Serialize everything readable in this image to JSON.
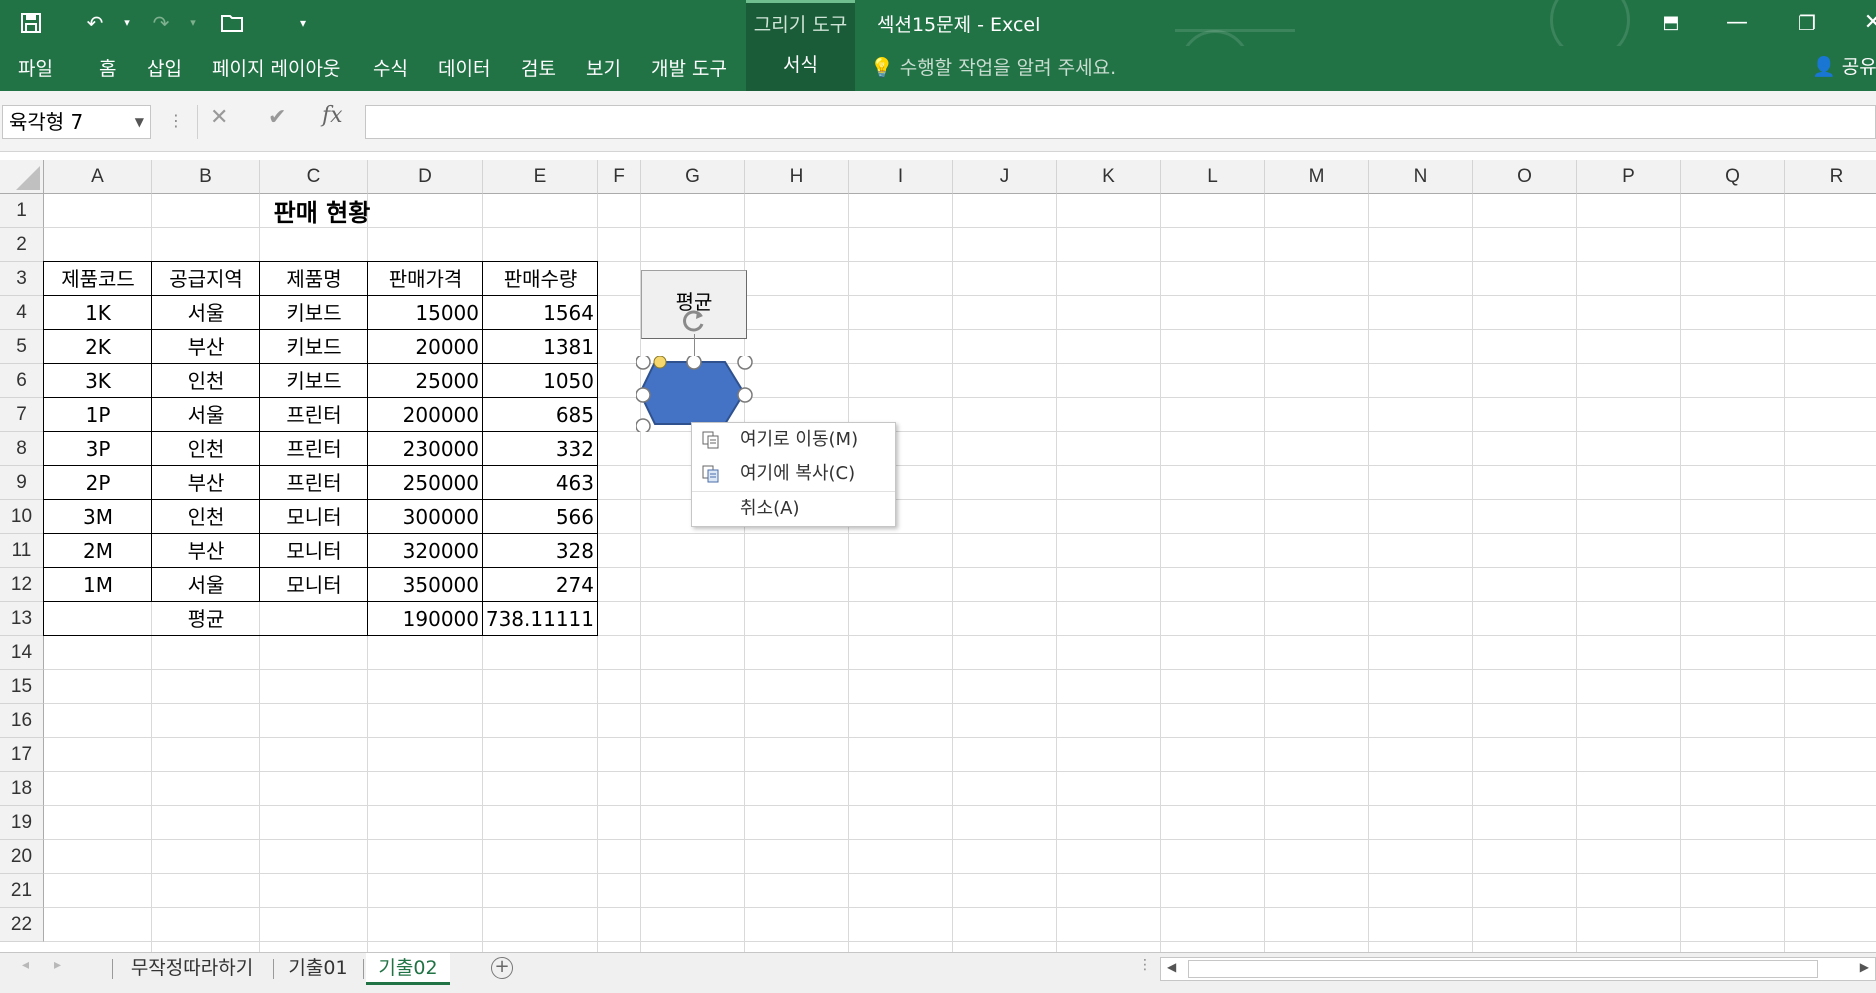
{
  "window": {
    "title": "섹션15문제 - Excel",
    "contextual_group": "그리기 도구",
    "colors": {
      "ribbon": "#217346",
      "contextual": "#1a5c38",
      "shape_fill": "#4472c4",
      "active_tab": "#217346"
    }
  },
  "qat": {
    "save_icon": "save-icon",
    "undo_icon": "undo-icon",
    "redo_icon": "redo-icon",
    "open_icon": "open-icon",
    "customize_icon": "customize-icon"
  },
  "ribbon": {
    "tabs": [
      "파일",
      "홈",
      "삽입",
      "페이지 레이아웃",
      "수식",
      "데이터",
      "검토",
      "보기",
      "개발 도구",
      "서식"
    ],
    "tell_me": "수행할 작업을 알려 주세요.",
    "share": "공유"
  },
  "formula_bar": {
    "name_box": "육각형 7",
    "fx_label": "fx",
    "cancel_glyph": "✕",
    "enter_glyph": "✔",
    "formula": ""
  },
  "grid": {
    "columns": [
      "A",
      "B",
      "C",
      "D",
      "E",
      "F",
      "G",
      "H",
      "I",
      "J",
      "K",
      "L",
      "M",
      "N",
      "O",
      "P",
      "Q",
      "R"
    ],
    "rows": [
      "1",
      "2",
      "3",
      "4",
      "5",
      "6",
      "7",
      "8",
      "9",
      "10",
      "11",
      "12",
      "13",
      "14",
      "15",
      "16",
      "17",
      "18",
      "19",
      "20",
      "21",
      "22"
    ]
  },
  "table": {
    "title": "판매 현황",
    "headers": [
      "제품코드",
      "공급지역",
      "제품명",
      "판매가격",
      "판매수량"
    ],
    "rows": [
      [
        "1K",
        "서울",
        "키보드",
        "15000",
        "1564"
      ],
      [
        "2K",
        "부산",
        "키보드",
        "20000",
        "1381"
      ],
      [
        "3K",
        "인천",
        "키보드",
        "25000",
        "1050"
      ],
      [
        "1P",
        "서울",
        "프린터",
        "200000",
        "685"
      ],
      [
        "3P",
        "인천",
        "프린터",
        "230000",
        "332"
      ],
      [
        "2P",
        "부산",
        "프린터",
        "250000",
        "463"
      ],
      [
        "3M",
        "인천",
        "모니터",
        "300000",
        "566"
      ],
      [
        "2M",
        "부산",
        "모니터",
        "320000",
        "328"
      ],
      [
        "1M",
        "서울",
        "모니터",
        "350000",
        "274"
      ]
    ],
    "avg_label": "평균",
    "avg_price": "190000",
    "avg_qty": "738.11111"
  },
  "macro_button": {
    "label": "평균"
  },
  "context_menu": {
    "items": [
      "여기로 이동(M)",
      "여기에 복사(C)",
      "취소(A)"
    ]
  },
  "sheet_tabs": {
    "tabs": [
      "무작정따라하기",
      "기출01",
      "기출02"
    ],
    "active": "기출02"
  }
}
